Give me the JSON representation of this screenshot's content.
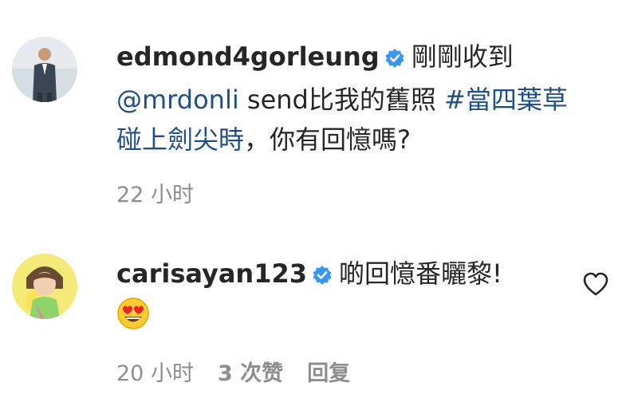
{
  "comments": [
    {
      "username": "edmond4gorleung",
      "text_lead": "剛剛收到",
      "mention": "@mrdonli",
      "text_mid": "send比我的舊照",
      "hashtag_a": "#當四葉草",
      "hashtag_b": "碰上劍尖時",
      "text_tail": "，你有回憶嗎?",
      "timestamp": "22 小时",
      "verified_icon": "verified-badge-icon"
    },
    {
      "username": "carisayan123",
      "text": "啲回憶番曬黎!",
      "emoji": "heart-eyes-emoji",
      "timestamp": "20 小时",
      "likes": "3 次赞",
      "reply_label": "回复",
      "verified_icon": "verified-badge-icon",
      "like_icon": "heart-outline-icon"
    }
  ],
  "colors": {
    "link": "#1e4f86",
    "verified": "#3897f0",
    "meta": "#8e8e8e",
    "text": "#262626"
  }
}
